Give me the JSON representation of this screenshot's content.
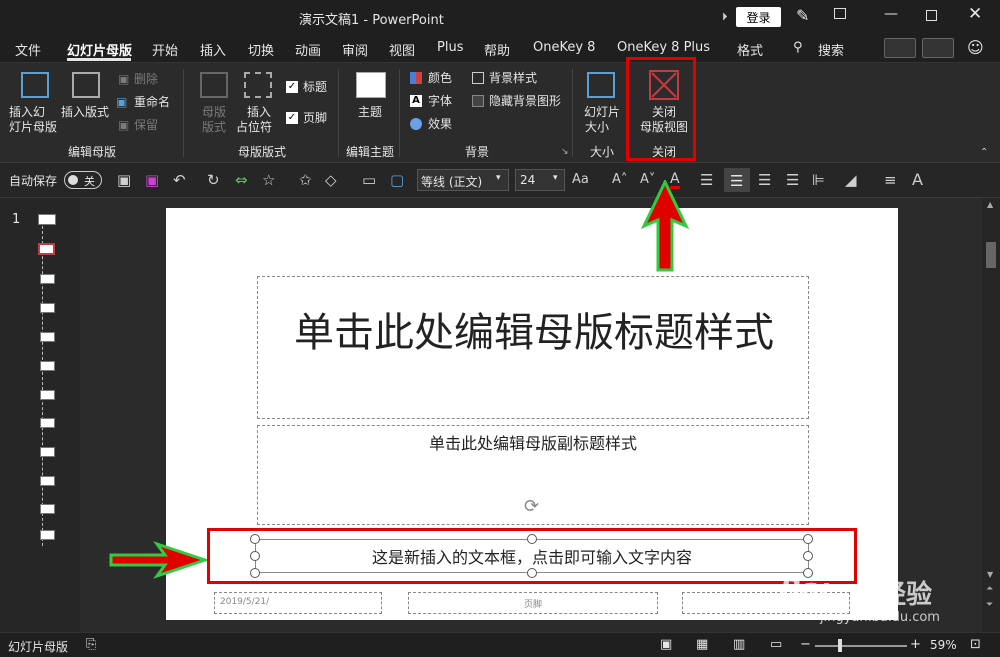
{
  "window": {
    "title": "演示文稿1  -  PowerPoint",
    "login_label": "登录"
  },
  "menu": {
    "items": [
      "文件",
      "幻灯片母版",
      "开始",
      "插入",
      "切换",
      "动画",
      "审阅",
      "视图",
      "Plus",
      "帮助",
      "OneKey 8",
      "OneKey 8 Plus",
      "格式"
    ],
    "search_label": "搜索"
  },
  "ribbon": {
    "insert_master_line1": "插入幻",
    "insert_master_line2": "灯片母版",
    "insert_layout": "插入版式",
    "delete": "删除",
    "rename": "重命名",
    "preserve": "保留",
    "group_edit_master": "编辑母版",
    "master_layout_line1": "母版",
    "master_layout_line2": "版式",
    "insert_placeholder_line1": "插入",
    "insert_placeholder_line2": "占位符",
    "title_check": "标题",
    "footer_check": "页脚",
    "group_master_layout": "母版版式",
    "theme": "主题",
    "group_edit_theme": "编辑主题",
    "colors": "颜色",
    "fonts": "字体",
    "effects": "效果",
    "bg_styles": "背景样式",
    "hide_bg": "隐藏背景图形",
    "group_background": "背景",
    "slide_size_line1": "幻灯片",
    "slide_size_line2": "大小",
    "group_size": "大小",
    "close_master_line1": "关闭",
    "close_master_line2": "母版视图",
    "group_close": "关闭"
  },
  "qat": {
    "autosave_label": "自动保存",
    "autosave_state": "关",
    "font_name": "等线 (正文)",
    "font_size": "24"
  },
  "thumbnails": {
    "slide_number": "1"
  },
  "slide": {
    "title": "单击此处编辑母版标题样式",
    "subtitle": "单击此处编辑母版副标题样式",
    "new_textbox": "这是新插入的文本框，点击即可输入文字内容",
    "date": "2019/5/21/",
    "footer": "页脚"
  },
  "status": {
    "view_label": "幻灯片母版",
    "zoom": "59%"
  },
  "watermark": {
    "text1": "Bai",
    "text2": "经验",
    "url": "jingyan.baidu.com"
  },
  "colors": {
    "highlight_red": "#e00000",
    "arrow_green": "#2ecc40",
    "accent_red": "#c8383f"
  }
}
